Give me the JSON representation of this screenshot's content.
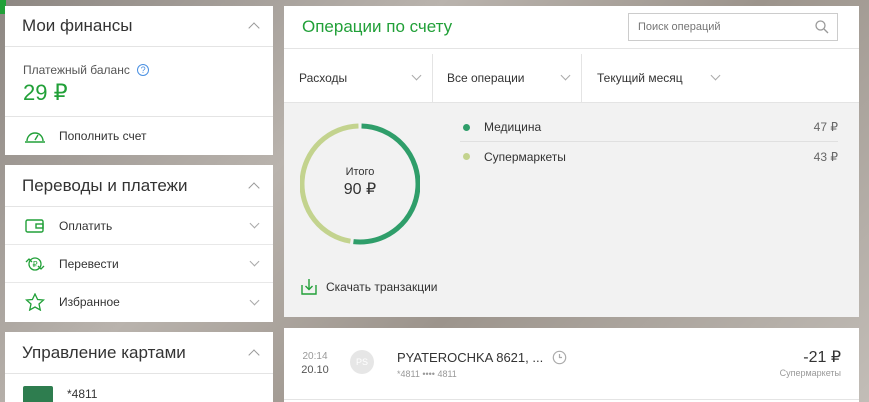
{
  "finances": {
    "title": "Мои финансы",
    "balance_label": "Платежный баланс",
    "balance_value": "29 ₽",
    "topup_label": "Пополнить счет"
  },
  "transfers": {
    "title": "Переводы и платежи",
    "items": [
      {
        "label": "Оплатить",
        "icon": "wallet-icon"
      },
      {
        "label": "Перевести",
        "icon": "transfer-icon"
      },
      {
        "label": "Избранное",
        "icon": "star-icon"
      }
    ]
  },
  "cards": {
    "title": "Управление картами",
    "card_number": "*4811"
  },
  "operations": {
    "title": "Операции по счету",
    "search_placeholder": "Поиск операций",
    "filters": [
      "Расходы",
      "Все операции",
      "Текущий месяц"
    ],
    "total_label": "Итого",
    "total_value": "90 ₽",
    "download_label": "Скачать транзакции",
    "categories": [
      {
        "name": "Медицина",
        "amount": "47 ₽",
        "value": 47,
        "color": "#2f9e6a"
      },
      {
        "name": "Супермаркеты",
        "amount": "43 ₽",
        "value": 43,
        "color": "#c3d38e"
      }
    ]
  },
  "transactions": [
    {
      "time": "20:14",
      "date": "20.10",
      "avatar": "PS",
      "merchant": "PYATEROCHKA 8621, ...",
      "card": "*4811 •••• 4811",
      "amount": "-21 ₽",
      "category": "Супермаркеты"
    }
  ],
  "colors": {
    "accent": "#21a038",
    "donut_primary": "#2f9e6a",
    "donut_secondary": "#c3d38e"
  }
}
